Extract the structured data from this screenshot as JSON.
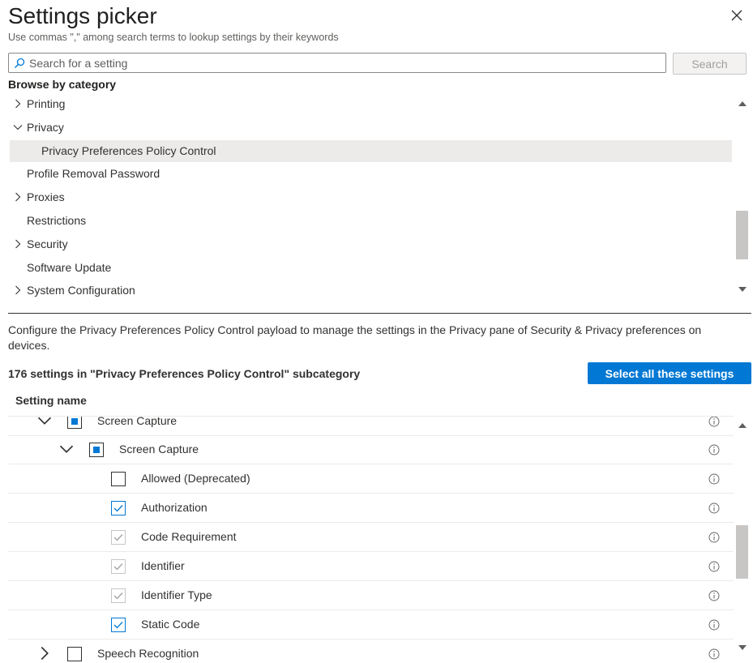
{
  "header": {
    "title": "Settings picker",
    "subtitle": "Use commas \",\" among search terms to lookup settings by their keywords"
  },
  "search": {
    "placeholder": "Search for a setting",
    "button_label": "Search"
  },
  "browse": {
    "heading": "Browse by category",
    "items": [
      {
        "label": "Printing",
        "chevron": "right",
        "indent": 1
      },
      {
        "label": "Privacy",
        "chevron": "down",
        "indent": 1
      },
      {
        "label": "Privacy Preferences Policy Control",
        "chevron": "none",
        "indent": 2,
        "selected": true
      },
      {
        "label": "Profile Removal Password",
        "chevron": "none",
        "indent": 1
      },
      {
        "label": "Proxies",
        "chevron": "right",
        "indent": 1
      },
      {
        "label": "Restrictions",
        "chevron": "none",
        "indent": 1
      },
      {
        "label": "Security",
        "chevron": "right",
        "indent": 1
      },
      {
        "label": "Software Update",
        "chevron": "none",
        "indent": 1
      },
      {
        "label": "System Configuration",
        "chevron": "right",
        "indent": 1
      }
    ]
  },
  "description": "Configure the Privacy Preferences Policy Control payload to manage the settings in the Privacy pane of Security & Privacy preferences on devices.",
  "count_text": "176 settings in \"Privacy Preferences Policy Control\" subcategory",
  "select_all_label": "Select all these settings",
  "table": {
    "column_header": "Setting name",
    "rows": [
      {
        "label": "Screen Capture",
        "level": 1,
        "expand": "down",
        "state": "partial"
      },
      {
        "label": "Screen Capture",
        "level": 2,
        "expand": "down",
        "state": "partial"
      },
      {
        "label": "Allowed (Deprecated)",
        "level": 3,
        "expand": "none",
        "state": "unchecked"
      },
      {
        "label": "Authorization",
        "level": 3,
        "expand": "none",
        "state": "checked"
      },
      {
        "label": "Code Requirement",
        "level": 3,
        "expand": "none",
        "state": "disabled-checked"
      },
      {
        "label": "Identifier",
        "level": 3,
        "expand": "none",
        "state": "disabled-checked"
      },
      {
        "label": "Identifier Type",
        "level": 3,
        "expand": "none",
        "state": "disabled-checked"
      },
      {
        "label": "Static Code",
        "level": 3,
        "expand": "none",
        "state": "checked"
      },
      {
        "label": "Speech Recognition",
        "level": 1,
        "expand": "right",
        "state": "unchecked"
      }
    ]
  },
  "colors": {
    "accent": "#0078d4",
    "selected_bg": "#edebe9",
    "disabled": "#c8c6c4"
  },
  "icons": {
    "close": "close-icon",
    "search": "search-icon",
    "info": "info-icon",
    "chevron_right": "chevron-right-icon",
    "chevron_down": "chevron-down-icon"
  }
}
